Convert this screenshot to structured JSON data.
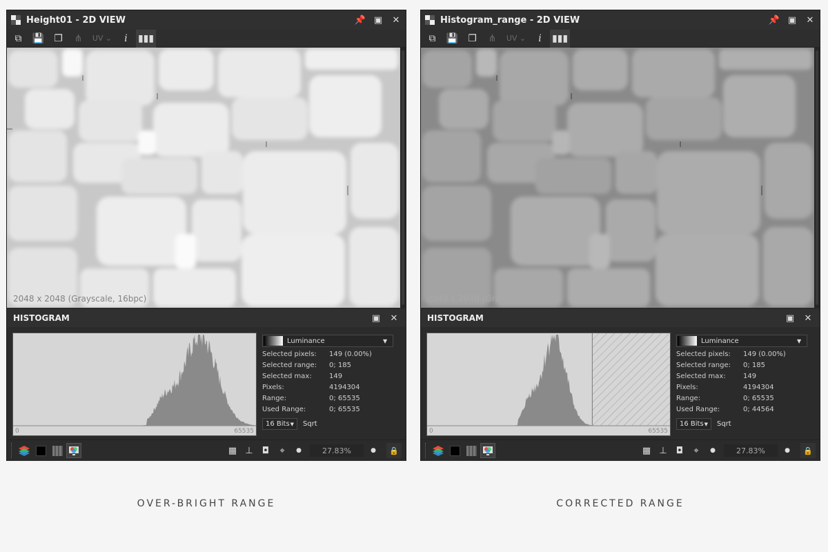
{
  "panels": [
    {
      "title": "Height01 - 2D VIEW",
      "toolbar": {
        "uv_label": "UV"
      },
      "viewport": {
        "image_info": "2048 x 2048 (Grayscale, 16bpc)",
        "brightness": "over-bright"
      },
      "histogram": {
        "title": "HISTOGRAM",
        "channel": "Luminance",
        "stats": [
          {
            "label": "Selected pixels:",
            "value": "149 (0.00%)"
          },
          {
            "label": "Selected range:",
            "value": "0; 185"
          },
          {
            "label": "Selected max:",
            "value": "149"
          },
          {
            "label": "Pixels:",
            "value": "4194304"
          },
          {
            "label": "Range:",
            "value": "0; 65535"
          },
          {
            "label": "Used Range:",
            "value": "0; 65535"
          }
        ],
        "bits": "16 Bits",
        "sqrt_label": "Sqrt",
        "axis_min": "0",
        "axis_max": "65535",
        "unused_fraction": 0
      },
      "zoom": "27.83%",
      "caption": "OVER-BRIGHT RANGE"
    },
    {
      "title": "Histogram_range - 2D VIEW",
      "toolbar": {
        "uv_label": "UV"
      },
      "viewport": {
        "image_info": "2048 x 2048 (Grayscale, 16bpc)",
        "brightness": "corrected"
      },
      "histogram": {
        "title": "HISTOGRAM",
        "channel": "Luminance",
        "stats": [
          {
            "label": "Selected pixels:",
            "value": "149 (0.00%)"
          },
          {
            "label": "Selected range:",
            "value": "0; 185"
          },
          {
            "label": "Selected max:",
            "value": "149"
          },
          {
            "label": "Pixels:",
            "value": "4194304"
          },
          {
            "label": "Range:",
            "value": "0; 65535"
          },
          {
            "label": "Used Range:",
            "value": "0; 44564"
          }
        ],
        "bits": "16 Bits",
        "sqrt_label": "Sqrt",
        "axis_min": "0",
        "axis_max": "65535",
        "unused_fraction": 0.32
      },
      "zoom": "27.83%",
      "caption": "CORRECTED RANGE"
    }
  ],
  "colors": {
    "panel_bg": "#2b2b2b",
    "titlebar_bg": "#303030",
    "histogram_bg": "#d6d6d6",
    "histogram_fill": "#8a8a8a",
    "page_bg": "#f5f5f5"
  }
}
